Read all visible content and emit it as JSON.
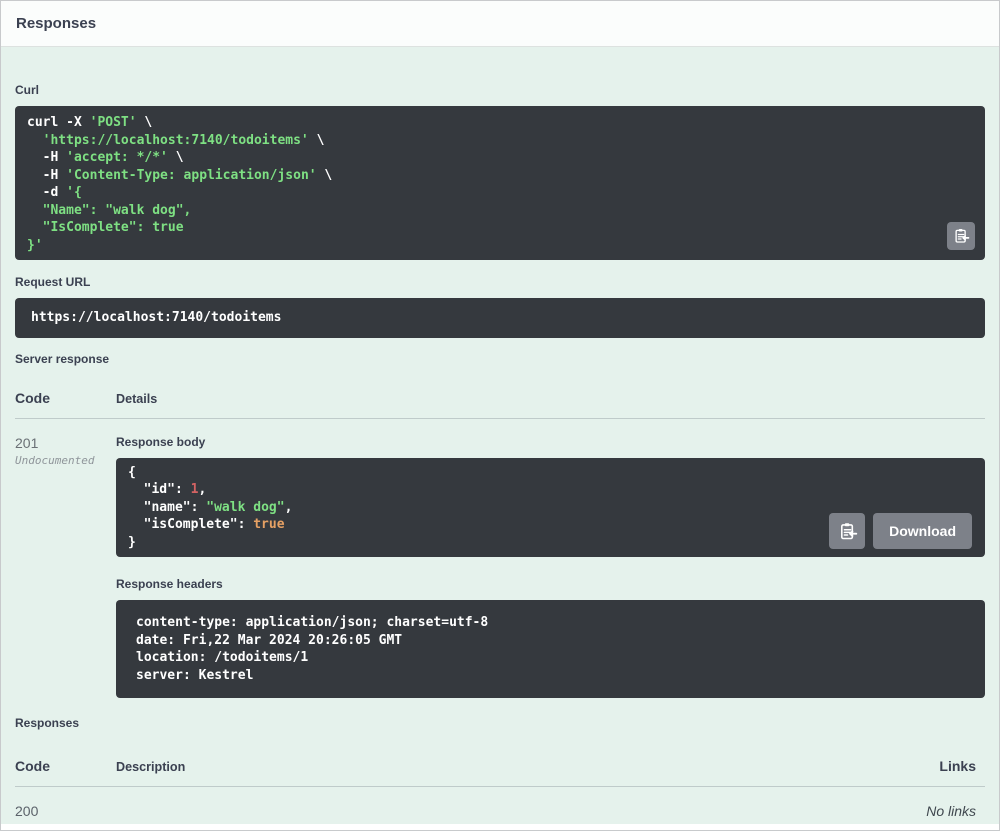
{
  "header": {
    "title": "Responses"
  },
  "icons": {
    "copy": "clipboard-arrow-icon"
  },
  "colors": {
    "section_bg": "#e5f2ec",
    "block_bg": "#35393e",
    "code_plain": "#ffffff",
    "code_string": "#7ee083",
    "code_number": "#d36363",
    "code_literal": "#e6a164",
    "button_bg": "#7d8189",
    "heading_text": "#3b4151"
  },
  "curl": {
    "label": "Curl",
    "lines": [
      [
        {
          "t": "curl -X ",
          "c": "p"
        },
        {
          "t": "'POST'",
          "c": "s"
        },
        {
          "t": " \\",
          "c": "p"
        }
      ],
      [
        {
          "t": "  ",
          "c": "p"
        },
        {
          "t": "'https://localhost:7140/todoitems'",
          "c": "s"
        },
        {
          "t": " \\",
          "c": "p"
        }
      ],
      [
        {
          "t": "  -H ",
          "c": "p"
        },
        {
          "t": "'accept: */*'",
          "c": "s"
        },
        {
          "t": " \\",
          "c": "p"
        }
      ],
      [
        {
          "t": "  -H ",
          "c": "p"
        },
        {
          "t": "'Content-Type: application/json'",
          "c": "s"
        },
        {
          "t": " \\",
          "c": "p"
        }
      ],
      [
        {
          "t": "  -d ",
          "c": "p"
        },
        {
          "t": "'{",
          "c": "s"
        }
      ],
      [
        {
          "t": "  \"Name\": \"walk dog\",",
          "c": "s"
        }
      ],
      [
        {
          "t": "  \"IsComplete\": true",
          "c": "s"
        }
      ],
      [
        {
          "t": "}'",
          "c": "s"
        }
      ]
    ]
  },
  "request_url": {
    "label": "Request URL",
    "value": "https://localhost:7140/todoitems"
  },
  "server_response": {
    "label": "Server response",
    "columns": {
      "code": "Code",
      "details": "Details"
    },
    "row": {
      "code": "201",
      "undocumented": "Undocumented",
      "response_body": {
        "label": "Response body",
        "lines": [
          [
            {
              "t": "{",
              "c": "p"
            }
          ],
          [
            {
              "t": "  \"id\": ",
              "c": "p"
            },
            {
              "t": "1",
              "c": "n"
            },
            {
              "t": ",",
              "c": "p"
            }
          ],
          [
            {
              "t": "  \"name\": ",
              "c": "p"
            },
            {
              "t": "\"walk dog\"",
              "c": "s"
            },
            {
              "t": ",",
              "c": "p"
            }
          ],
          [
            {
              "t": "  \"isComplete\": ",
              "c": "p"
            },
            {
              "t": "true",
              "c": "l"
            }
          ],
          [
            {
              "t": "}",
              "c": "p"
            }
          ]
        ],
        "download_label": "Download"
      },
      "response_headers": {
        "label": "Response headers",
        "lines": [
          "content-type: application/json; charset=utf-8 ",
          "date: Fri,22 Mar 2024 20:26:05 GMT ",
          "location: /todoitems/1 ",
          "server: Kestrel "
        ]
      }
    }
  },
  "responses_table": {
    "label": "Responses",
    "columns": {
      "code": "Code",
      "description": "Description",
      "links": "Links"
    },
    "row": {
      "code": "200",
      "description": "",
      "links": "No links"
    }
  }
}
